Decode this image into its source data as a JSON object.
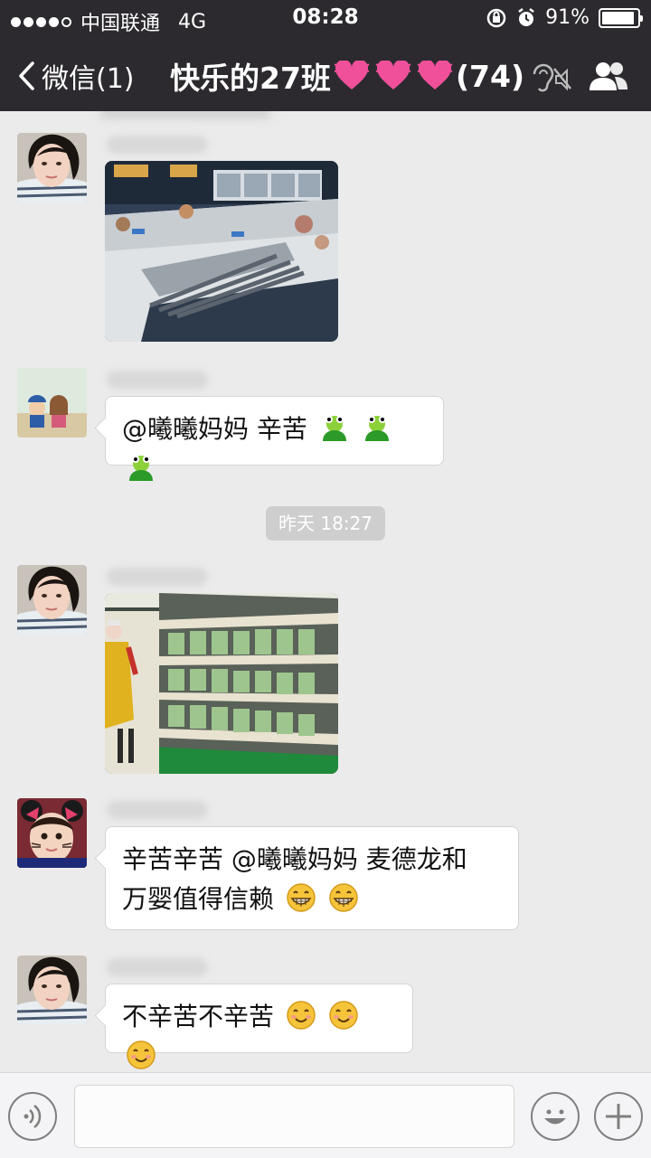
{
  "status_bar": {
    "carrier": "中国联通",
    "network": "4G",
    "time": "08:28",
    "battery": "91%",
    "battery_level": 0.91
  },
  "nav": {
    "back_label": "微信(1)",
    "group_name": "快乐的27班",
    "member_count": "(74)"
  },
  "chat": {
    "messages": [
      {
        "type": "image",
        "content": "seafood-counter-photo"
      },
      {
        "type": "text",
        "text": "@曦曦妈妈 辛苦",
        "emoji": [
          "frog",
          "frog",
          "frog"
        ]
      },
      {
        "type": "timestamp",
        "text": "昨天 18:27"
      },
      {
        "type": "image",
        "content": "vegetable-shelf-photo"
      },
      {
        "type": "text",
        "lines": [
          "辛苦辛苦 @曦曦妈妈 麦德龙和",
          "万婴值得信赖"
        ],
        "emoji": [
          "grin",
          "grin"
        ]
      },
      {
        "type": "text",
        "text": "不辛苦不辛苦",
        "emoji": [
          "smile",
          "smile",
          "smile"
        ]
      }
    ]
  },
  "input_bar": {
    "placeholder": ""
  },
  "colors": {
    "header_bg": "#2c2a2f",
    "chat_bg": "#ebebeb",
    "bubble_bg": "#ffffff",
    "timestamp_bg": "#cecece",
    "heart_pink": "#f0509a"
  }
}
